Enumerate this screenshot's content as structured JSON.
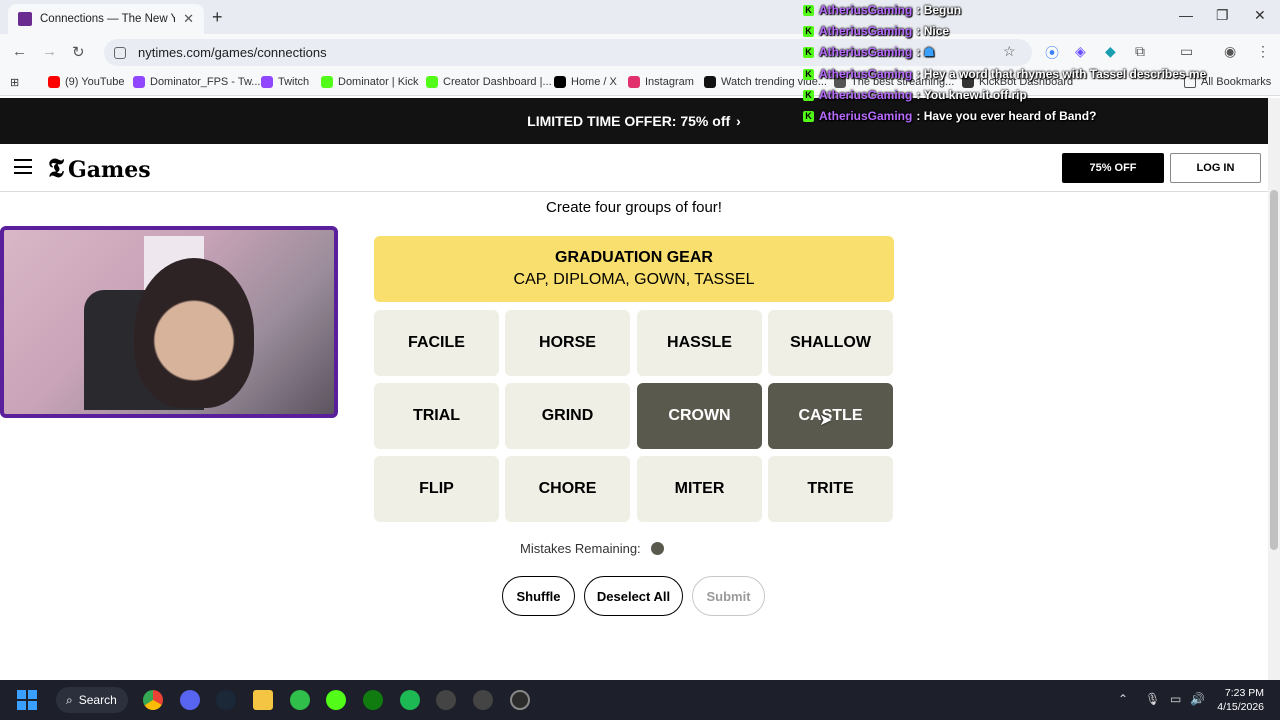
{
  "browser": {
    "tab_title": "Connections — The New York T",
    "url": "nytimes.com/games/connections",
    "bookmarks": [
      "(9) YouTube",
      "Dominator_FPS - Tw...",
      "Twitch",
      "Dominator | Kick",
      "Creator Dashboard |...",
      "Home / X",
      "Instagram",
      "Watch trending vide...",
      "The best streaming...",
      "KickBot Dashboard",
      "All Bookmarks"
    ]
  },
  "banner": {
    "text": "LIMITED TIME OFFER:  75% off"
  },
  "header": {
    "logo": "Games",
    "offer_button": "75% OFF",
    "login_button": "LOG IN"
  },
  "game": {
    "instructions": "Create four groups of four!",
    "solved_group": {
      "title": "GRADUATION GEAR",
      "words": "CAP, DIPLOMA, GOWN, TASSEL",
      "color": "#f9df6d"
    },
    "cards": [
      {
        "word": "FACILE",
        "selected": false
      },
      {
        "word": "HORSE",
        "selected": false
      },
      {
        "word": "HASSLE",
        "selected": false
      },
      {
        "word": "SHALLOW",
        "selected": false
      },
      {
        "word": "TRIAL",
        "selected": false
      },
      {
        "word": "GRIND",
        "selected": false
      },
      {
        "word": "CROWN",
        "selected": true
      },
      {
        "word": "CASTLE",
        "selected": true
      },
      {
        "word": "FLIP",
        "selected": false
      },
      {
        "word": "CHORE",
        "selected": false
      },
      {
        "word": "MITER",
        "selected": false
      },
      {
        "word": "TRITE",
        "selected": false
      }
    ],
    "mistakes_label": "Mistakes Remaining:",
    "mistakes_remaining": 1,
    "buttons": {
      "shuffle": "Shuffle",
      "deselect": "Deselect All",
      "submit": "Submit"
    }
  },
  "chat": [
    {
      "user": "AtheriusGaming",
      "message": "Begun"
    },
    {
      "user": "AtheriusGaming",
      "message": "Nice"
    },
    {
      "user": "AtheriusGaming",
      "message": ""
    },
    {
      "user": "AtheriusGaming",
      "message": "Hey a word that rhymes with Tassel describes me"
    },
    {
      "user": "AtheriusGaming",
      "message": "You knew it off rip"
    },
    {
      "user": "AtheriusGaming",
      "message": "Have you ever heard of  Band?"
    }
  ],
  "taskbar": {
    "search": "Search",
    "time": "7:23 PM",
    "date": "4/15/2026"
  }
}
